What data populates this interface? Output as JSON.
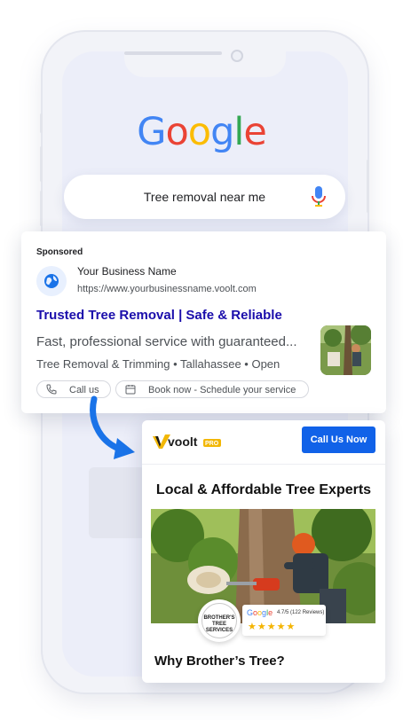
{
  "search": {
    "brand": "Google",
    "query": "Tree removal near me",
    "mic_icon": "microphone-icon"
  },
  "ad": {
    "sponsored_label": "Sponsored",
    "business_name": "Your Business Name",
    "url": "https://www.yourbusinessname.voolt.com",
    "headline": "Trusted Tree Removal | Safe & Reliable",
    "description": "Fast, professional service with guaranteed...",
    "meta": "Tree Removal & Trimming • Tallahassee • Open",
    "chips": [
      {
        "label": "Call us",
        "icon": "phone-icon"
      },
      {
        "label": "Book now - Schedule your service",
        "icon": "calendar-icon"
      }
    ],
    "link_color": "#1a0dab"
  },
  "landing": {
    "logo_text": "voolt",
    "logo_badge": "PRO",
    "cta_label": "Call Us Now",
    "headline": "Local & Affordable Tree Experts",
    "badge_text": "BROTHER'S TREE SERVICES",
    "review_brand": "Google",
    "review_text": "4.7/5 (122 Reviews)",
    "rating": 4.7,
    "stars": "★★★★★",
    "why_heading": "Why Brother’s Tree?",
    "accent_color": "#1162e8"
  }
}
